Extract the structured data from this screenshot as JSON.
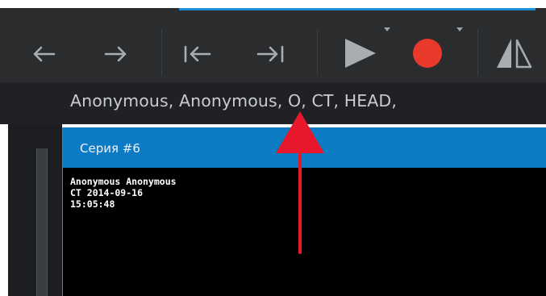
{
  "toolbar": {
    "buttons": [
      {
        "icon": "back-arrow-icon"
      },
      {
        "icon": "forward-arrow-icon"
      },
      {
        "icon": "first-frame-icon"
      },
      {
        "icon": "last-frame-icon"
      },
      {
        "icon": "play-icon",
        "has_dropdown": true
      },
      {
        "icon": "record-icon",
        "has_dropdown": true
      },
      {
        "icon": "flip-horizontal-icon"
      }
    ]
  },
  "patient_info": "Anonymous, Anonymous, O, CT, HEAD,",
  "series": {
    "title": "Серия #6",
    "overlay": {
      "line1": "Anonymous Anonymous",
      "line2": "CT 2014-09-16",
      "line3": "15:05:48"
    }
  },
  "colors": {
    "toolbar_bg": "#2a2c2e",
    "accent": "#1a8ed8",
    "series_header": "#0d7ac4",
    "record": "#e8392b",
    "annotation_arrow": "#e8172b"
  }
}
